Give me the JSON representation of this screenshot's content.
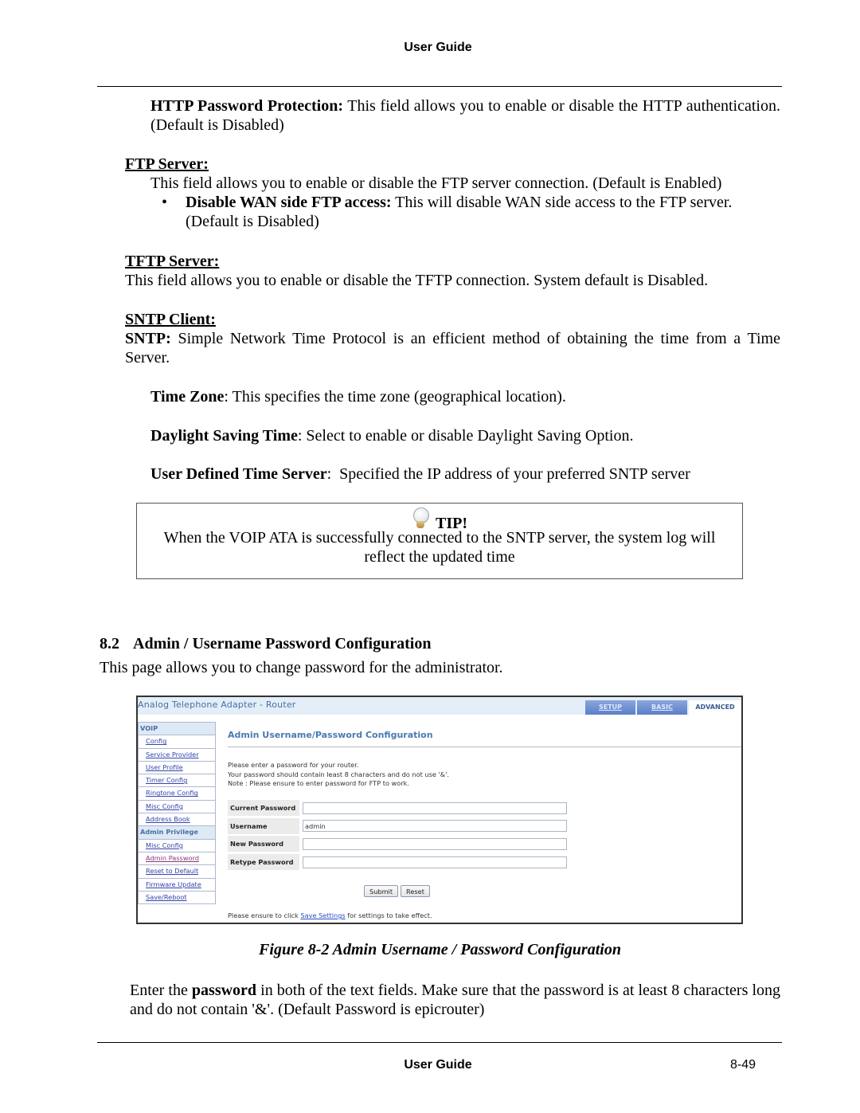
{
  "page_header": {
    "title": "User Guide"
  },
  "http_password": {
    "label": "HTTP Password Protection:",
    "text": " This field allows you to enable or disable the HTTP authentication. (Default is Disabled)"
  },
  "ftp_server": {
    "heading": "FTP Server:",
    "text": "This field allows you to enable or disable the FTP server connection. (Default is Enabled)",
    "bullet": {
      "label": "Disable WAN side FTP access:",
      "text": " This will disable WAN side access to the FTP server. (Default is Disabled)"
    }
  },
  "tftp_server": {
    "heading": "TFTP Server:",
    "text": "This field allows you to enable or disable the TFTP connection. System default is Disabled."
  },
  "sntp_client": {
    "heading": "SNTP Client:",
    "label": "SNTP:",
    "text": " Simple Network Time Protocol is an efficient method of obtaining the time from a Time Server.",
    "items": [
      {
        "label": "Time Zone",
        "text": ": This specifies the time zone (geographical location)."
      },
      {
        "label": "Daylight Saving Time",
        "text": ": Select to enable or disable Daylight Saving Option."
      },
      {
        "label": "User Defined Time Server",
        "text": ":  Specified the IP address of your preferred SNTP server"
      }
    ]
  },
  "tip": {
    "icon": "lightbulb-icon",
    "title": "TIP!",
    "line1": "When the VOIP ATA is successfully connected to the SNTP server, the system log will",
    "line2": "reflect the updated time"
  },
  "section_8_2": {
    "number": "8.2",
    "title": "Admin / Username Password Configuration",
    "intro": "This page allows you to change password for the administrator."
  },
  "router_ui": {
    "app_title": "Analog Telephone Adapter - Router",
    "tabs": [
      {
        "label": "SETUP",
        "active": false
      },
      {
        "label": "BASIC",
        "active": false
      },
      {
        "label": "ADVANCED",
        "active": true
      }
    ],
    "sidebar": {
      "voip_header": "VOIP",
      "voip_items": [
        "Config",
        "Service Provider",
        "User Profile",
        "Timer Config",
        "Ringtone Config",
        "Misc Config",
        "Address Book"
      ],
      "admin_header": "Admin Privilege",
      "admin_items": [
        "Misc Config",
        "Admin Password",
        "Reset to Default",
        "Firmware Update",
        "Save/Reboot"
      ]
    },
    "content_title": "Admin Username/Password Configuration",
    "intro_lines": [
      "Please enter a password for your router.",
      "Your password should contain least 8 characters and do not use '&'.",
      "Note : Please ensure to enter password for FTP to work."
    ],
    "fields": [
      {
        "label": "Current Password",
        "value": ""
      },
      {
        "label": "Username",
        "value": "admin"
      },
      {
        "label": "New Password",
        "value": ""
      },
      {
        "label": "Retype Password",
        "value": ""
      }
    ],
    "submit_label": "Submit",
    "reset_label": "Reset",
    "footer_pre": "Please ensure to click ",
    "footer_link": "Save Settings",
    "footer_post": " for settings to take effect."
  },
  "figure_caption": "Figure 8-2 Admin Username / Password Configuration",
  "closing": {
    "pre": "Enter the ",
    "bold": "password",
    "post": " in both of the text fields. Make sure that the password is at least 8 characters long and do not contain '&'. (Default Password is epicrouter)"
  },
  "page_footer": {
    "title": "User Guide",
    "page_number": "8-49"
  }
}
